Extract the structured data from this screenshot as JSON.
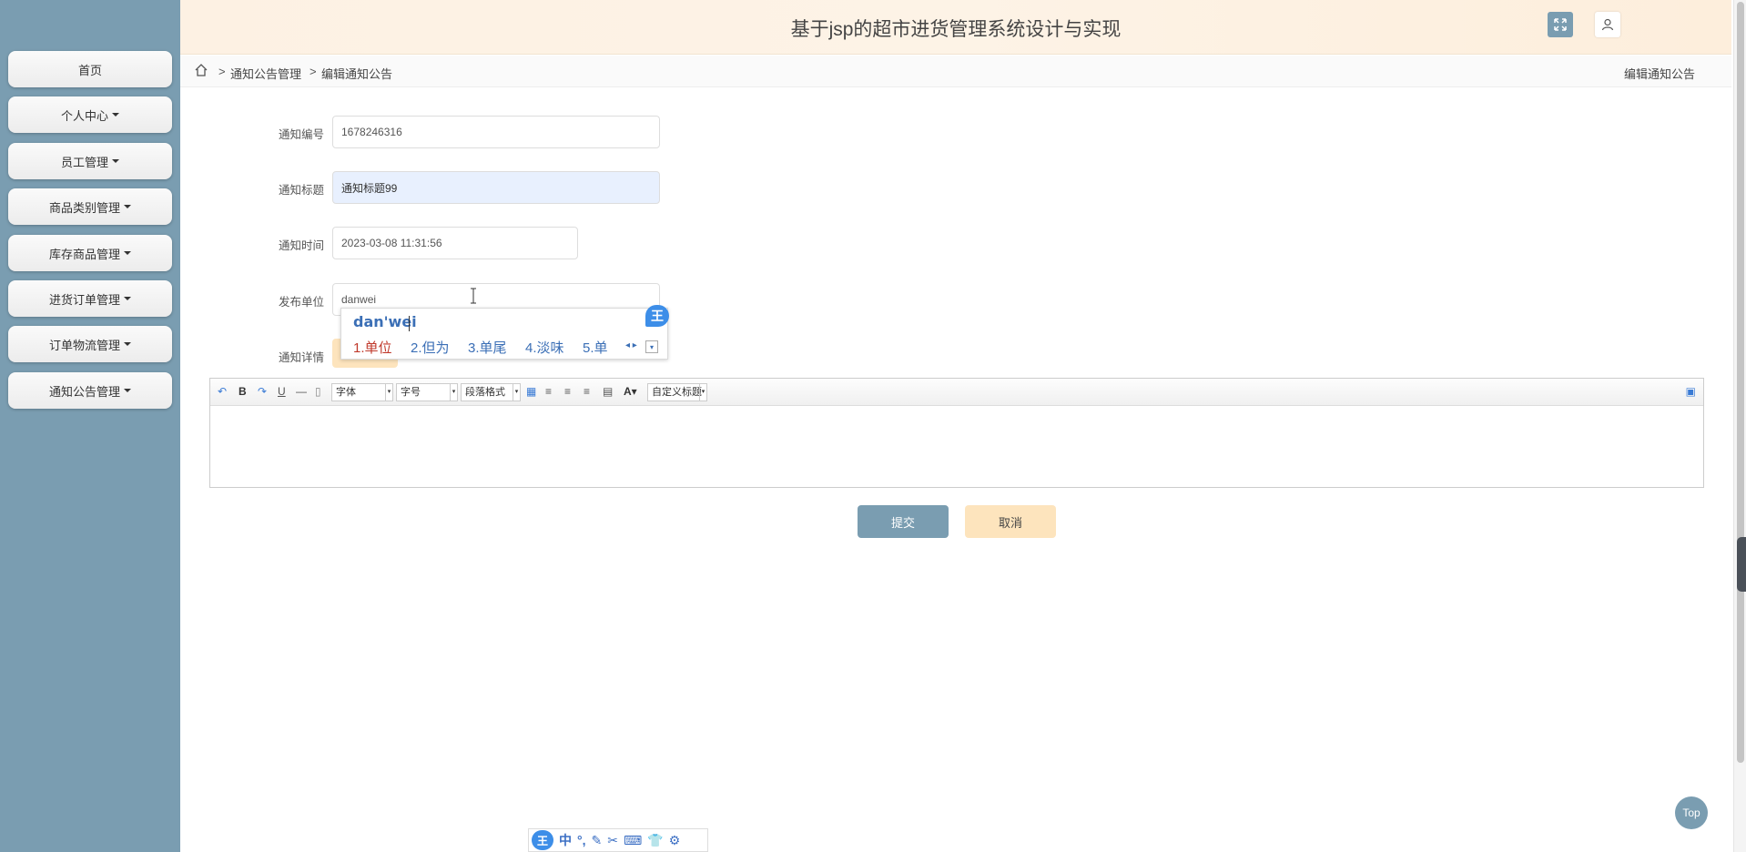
{
  "app": {
    "title": "基于jsp的超市进货管理系统设计与实现"
  },
  "sidebar": {
    "items": [
      {
        "label": "首页",
        "has_caret": false
      },
      {
        "label": "个人中心",
        "has_caret": true
      },
      {
        "label": "员工管理",
        "has_caret": true
      },
      {
        "label": "商品类别管理",
        "has_caret": true
      },
      {
        "label": "库存商品管理",
        "has_caret": true
      },
      {
        "label": "进货订单管理",
        "has_caret": true
      },
      {
        "label": "订单物流管理",
        "has_caret": true
      },
      {
        "label": "通知公告管理",
        "has_caret": true
      }
    ]
  },
  "breadcrumb": {
    "sep": ">",
    "items": [
      "通知公告管理",
      "编辑通知公告"
    ],
    "current_right": "编辑通知公告"
  },
  "form": {
    "id_label": "通知编号",
    "id_value": "1678246316",
    "title_label": "通知标题",
    "title_value": "通知标题99",
    "time_label": "通知时间",
    "time_value": "2023-03-08 11:31:56",
    "unit_label": "发布单位",
    "unit_value": "danwei",
    "detail_label": "通知详情"
  },
  "ime": {
    "pinyin": "dan'wei",
    "logo": "王",
    "candidates": [
      "1.单位",
      "2.但为",
      "3.单尾",
      "4.淡味",
      "5.单"
    ]
  },
  "editor": {
    "font_select": "字体",
    "size_select": "字号",
    "paragraph_select": "段落格式",
    "custom_title_select": "自定义标题"
  },
  "buttons": {
    "submit": "提交",
    "cancel": "取消",
    "top": "Top"
  },
  "ime_bar": {
    "logo": "王",
    "mode": "中",
    "punct": "°,",
    "pen": "✎",
    "scissors": "✂",
    "keyboard": "⌨",
    "skin": "👕",
    "gear": "⚙"
  },
  "colors": {
    "sidebar": "#7a9db1",
    "header": "#fdf1e3",
    "primary_button": "#7a9db1",
    "secondary_button": "#fde4bd"
  }
}
